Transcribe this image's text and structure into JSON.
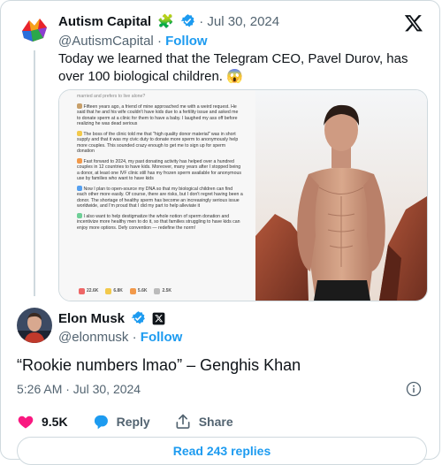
{
  "quoted": {
    "name": "Autism Capital",
    "name_emoji": "🧩",
    "date": "· Jul 30, 2024",
    "handle": "@AutismCapital",
    "follow": "Follow",
    "text": "Today we learned that the Telegram CEO, Pavel Durov, has over 100 biological children. 😱",
    "media": {
      "screenshot_paragraphs": [
        "married and prefers to live alone?",
        "Fifteen years ago, a friend of mine approached me with a weird request. He said that he and his wife couldn't have kids due to a fertility issue and asked me to donate sperm at a clinic for them to have a baby. I laughed my ass off before realizing he was dead serious",
        "The boss of the clinic told me that \"high quality donor material\" was in short supply and that it was my civic duty to donate more sperm to anonymously help more couples. This sounded crazy enough to get me to sign up for sperm donation",
        "Fast forward to 2024, my past donating activity has helped over a hundred couples in 12 countries to have kids. Moreover, many years after I stopped being a donor, at least one IVF clinic still has my frozen sperm available for anonymous use by families who want to have kids",
        "Now I plan to open-source my DNA so that my biological children can find each other more easily. Of course, there are risks, but I don't regret having been a donor. The shortage of healthy sperm has become an increasingly serious issue worldwide, and I'm proud that I did my part to help alleviate it",
        "I also want to help destigmatize the whole notion of sperm donation and incentivize more healthy men to do it, so that families struggling to have kids can enjoy more options. Defy convention — redefine the norm!"
      ],
      "stats": [
        "22.6K",
        "6.8K",
        "5.6K",
        "2.5K"
      ]
    }
  },
  "main": {
    "name": "Elon Musk",
    "handle": "@elonmusk",
    "follow": "Follow",
    "text": "“Rookie numbers lmao” – Genghis Khan",
    "timestamp": "5:26 AM · Jul 30, 2024",
    "actions": {
      "likes": "9.5K",
      "reply": "Reply",
      "share": "Share"
    },
    "read_replies": "Read 243 replies"
  },
  "colors": {
    "accent": "#1d9bf0",
    "like": "#f91880",
    "muted": "#536471",
    "verified_gold": "#e2b719"
  },
  "icons": [
    "puzzle-avatar",
    "verified-badge",
    "x-logo",
    "info-icon",
    "heart-icon",
    "reply-icon",
    "share-icon",
    "x-affiliate-badge"
  ]
}
